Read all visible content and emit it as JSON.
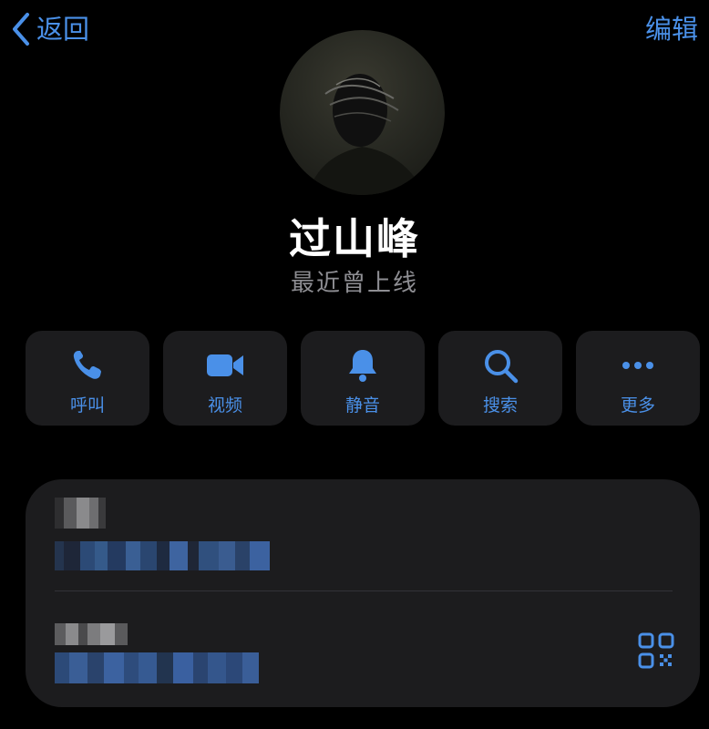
{
  "nav": {
    "back_label": "返回",
    "edit_label": "编辑"
  },
  "profile": {
    "name": "过山峰",
    "status": "最近曾上线"
  },
  "actions": [
    {
      "label": "呼叫",
      "icon": "phone-icon"
    },
    {
      "label": "视频",
      "icon": "video-camera-icon"
    },
    {
      "label": "静音",
      "icon": "bell-icon"
    },
    {
      "label": "搜索",
      "icon": "search-icon"
    },
    {
      "label": "更多",
      "icon": "ellipsis-icon"
    }
  ],
  "info_rows": [
    {
      "label": "pixelated",
      "value": "pixelated"
    },
    {
      "label": "pixelated",
      "value": "pixelated",
      "trailing_icon": "qr-code-icon"
    }
  ],
  "colors": {
    "accent": "#4a90e8",
    "background": "#000000",
    "card": "#1c1c1e",
    "secondary_text": "#8e8e93"
  }
}
